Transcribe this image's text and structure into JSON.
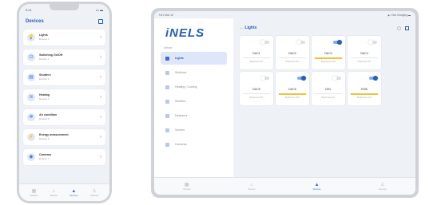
{
  "colors": {
    "accent": "#2a5dbb",
    "active_bg": "#dde7f9",
    "on_bar": "#f0c23c"
  },
  "phone": {
    "status": {
      "time": "9:41",
      "signal": "••• ▬"
    },
    "header": {
      "title": "Devices"
    },
    "items": [
      {
        "icon": "bulb-icon",
        "glyph": "💡",
        "name": "Lights",
        "sub": "Devices 1"
      },
      {
        "icon": "switch-icon",
        "glyph": "⏻",
        "name": "Switching On/Off",
        "sub": "Devices 2"
      },
      {
        "icon": "shutters-icon",
        "glyph": "▤",
        "name": "Shutters",
        "sub": "Devices 3"
      },
      {
        "icon": "heating-icon",
        "glyph": "≋",
        "name": "Heating",
        "sub": "Devices 4"
      },
      {
        "icon": "aircondition-icon",
        "glyph": "❄",
        "name": "Air condition",
        "sub": "Devices 5"
      },
      {
        "icon": "energy-icon",
        "glyph": "⚡",
        "name": "Energy measurement",
        "sub": "Devices 6"
      },
      {
        "icon": "camera-icon",
        "glyph": "◉",
        "name": "Cameras",
        "sub": "Devices 7"
      }
    ],
    "tabs": [
      {
        "icon": "scenes-icon",
        "glyph": "▦",
        "label": "Scenes"
      },
      {
        "icon": "home-icon",
        "glyph": "⌂",
        "label": "Rooms"
      },
      {
        "icon": "devices-icon",
        "glyph": "▲",
        "label": "Devices",
        "active": true
      },
      {
        "icon": "account-icon",
        "glyph": "♙",
        "label": "Account"
      }
    ]
  },
  "tablet": {
    "status": {
      "time": "9:41  Mon 16",
      "battery": "◆ ▾ Not Charging ▬"
    },
    "logo": "iNELS",
    "section": "Device",
    "nav": [
      {
        "label": "Lights",
        "active": true
      },
      {
        "label": "Switches"
      },
      {
        "label": "Heating / Cooling"
      },
      {
        "label": "Shutters"
      },
      {
        "label": "Detectors"
      },
      {
        "label": "Scenes"
      },
      {
        "label": "Cameras"
      }
    ],
    "main": {
      "back": "←  Lights"
    },
    "cards": [
      {
        "name": "DAC1",
        "sub": "Brightness 0%",
        "on": false
      },
      {
        "name": "DAC2",
        "sub": "Brightness 0%",
        "on": false
      },
      {
        "name": "DAC3",
        "sub": "Brightness 70%",
        "on": true
      },
      {
        "name": "DAC4",
        "sub": "Brightness 0%",
        "on": false
      },
      {
        "name": "DAC5",
        "sub": "Brightness 0%",
        "on": false
      },
      {
        "name": "DAC6",
        "sub": "Brightness 70%",
        "on": true
      },
      {
        "name": "DRL",
        "sub": "Brightness 0%",
        "on": false
      },
      {
        "name": "RGB",
        "sub": "Brightness 70%",
        "on": true
      }
    ],
    "tabs": [
      {
        "icon": "scenes-icon",
        "glyph": "▦",
        "label": "Scenes"
      },
      {
        "icon": "home-icon",
        "glyph": "⌂",
        "label": "Rooms"
      },
      {
        "icon": "devices-icon",
        "glyph": "▲",
        "label": "Devices",
        "active": true
      },
      {
        "icon": "account-icon",
        "glyph": "♙",
        "label": "Account"
      }
    ]
  }
}
